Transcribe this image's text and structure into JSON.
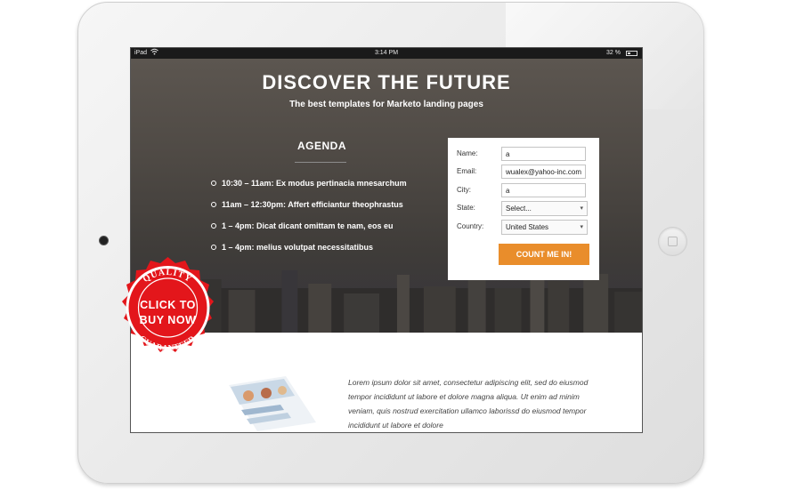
{
  "device": {
    "status_bar": {
      "carrier": "iPad",
      "time": "3:14 PM",
      "battery": "32 %"
    }
  },
  "hero": {
    "title": "DISCOVER THE FUTURE",
    "subtitle": "The best templates for Marketo landing pages"
  },
  "agenda": {
    "title": "AGENDA",
    "items": [
      "10:30 – 11am: Ex modus pertinacia mnesarchum",
      "11am – 12:30pm: Affert efficiantur theophrastus",
      "1 – 4pm: Dicat dicant omittam te nam, eos eu",
      "1 – 4pm: melius volutpat necessitatibus"
    ]
  },
  "form": {
    "fields": [
      {
        "label": "Name:",
        "value": "a"
      },
      {
        "label": "Email:",
        "value": "wualex@yahoo-inc.com"
      },
      {
        "label": "City:",
        "value": "a"
      }
    ],
    "state": {
      "label": "State:",
      "value": "Select..."
    },
    "country": {
      "label": "Country:",
      "value": "United States"
    },
    "submit_label": "COUNT ME IN!"
  },
  "content": {
    "body_text": "Lorem ipsum dolor sit amet, consectetur adipiscing elit, sed do eiusmod tempor incididunt ut labore et dolore magna aliqua. Ut enim ad minim veniam, quis nostrud exercitation ullamco laborissd do eiusmod tempor incididunt ut labore et dolore"
  },
  "badge": {
    "line1": "CLICK TO",
    "line2": "BUY NOW",
    "ring_top": "QUALITY",
    "ring_bottom": "GUARANTEED",
    "color": "#e3161b"
  },
  "colors": {
    "accent_button": "#e98d2b"
  }
}
